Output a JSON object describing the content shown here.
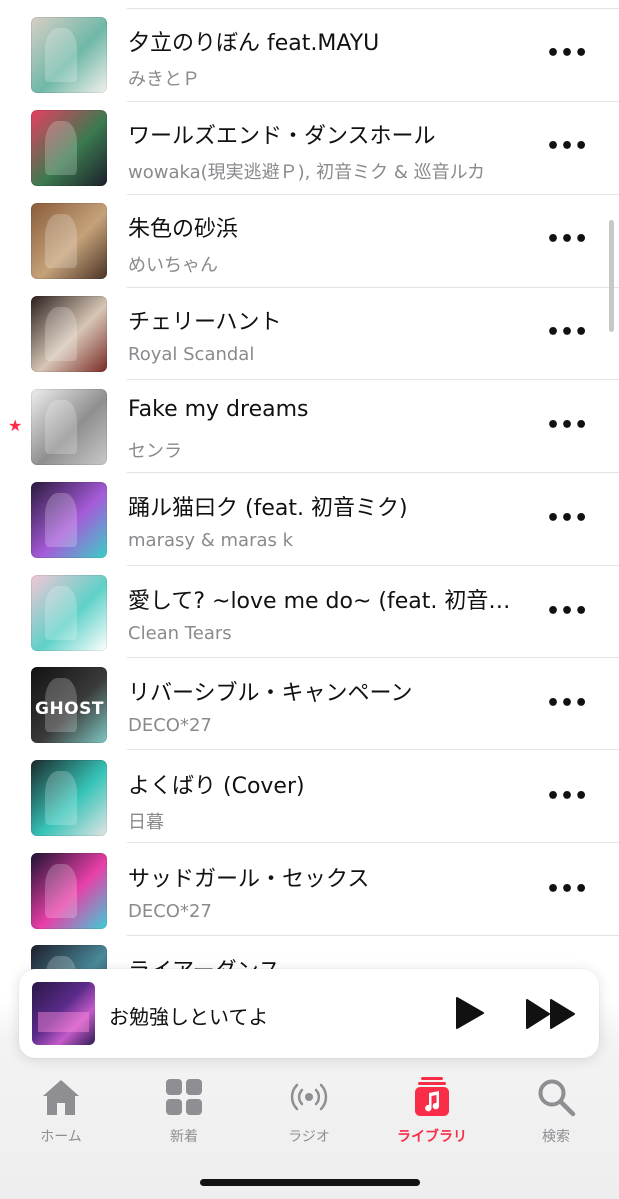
{
  "song_list": {
    "rows": [
      {
        "title": "夕立のりぼん feat.MAYU",
        "artist": "みきとＰ",
        "more_icon": "ellipsis-icon",
        "art_colors": [
          "#d9cfc6",
          "#6fb8a8",
          "#f4f1ec"
        ]
      },
      {
        "title": "ワールズエンド・ダンスホール",
        "artist": "wowaka(現実逃避Ｐ), 初音ミク & 巡音ルカ",
        "more_icon": "ellipsis-icon",
        "art_colors": [
          "#e83e62",
          "#3b7a4f",
          "#1c1f2a"
        ]
      },
      {
        "title": "朱色の砂浜",
        "artist": "めいちゃん",
        "more_icon": "ellipsis-icon",
        "art_colors": [
          "#8a5c3a",
          "#c5a27a",
          "#4a3325"
        ]
      },
      {
        "title": "チェリーハント",
        "artist": "Royal Scandal",
        "more_icon": "ellipsis-icon",
        "art_colors": [
          "#2b1f1c",
          "#d7c6b6",
          "#7a2a26"
        ]
      },
      {
        "title": "Fake my dreams",
        "artist": "センラ",
        "more_icon": "ellipsis-icon",
        "favorite": true,
        "favorite_icon": "star-icon",
        "art_colors": [
          "#eeeeee",
          "#8f8f8f",
          "#c9c9c9"
        ]
      },
      {
        "title": "踊ル猫曰ク (feat. 初音ミク)",
        "artist": "marasy & maras k",
        "more_icon": "ellipsis-icon",
        "art_colors": [
          "#2a1a3c",
          "#a55bd9",
          "#39d0c7"
        ]
      },
      {
        "title": "愛して? ~love me do~ (feat. 初音…",
        "artist": "Clean Tears",
        "more_icon": "ellipsis-icon",
        "art_colors": [
          "#f3c6d6",
          "#5fd1c8",
          "#ffffff"
        ]
      },
      {
        "title": "リバーシブル・キャンペーン",
        "artist": "DECO*27",
        "more_icon": "ellipsis-icon",
        "badge": "GHOST",
        "art_colors": [
          "#111111",
          "#3a3a3a",
          "#7fc9c4"
        ]
      },
      {
        "title": "よくばり (Cover)",
        "artist": "日暮",
        "more_icon": "ellipsis-icon",
        "art_colors": [
          "#1a2a2a",
          "#36c4b8",
          "#e4e4e4"
        ]
      },
      {
        "title": "サッドガール・セックス",
        "artist": "DECO*27",
        "more_icon": "ellipsis-icon",
        "art_colors": [
          "#1d1330",
          "#e83fa8",
          "#3ad0d6"
        ]
      },
      {
        "title": "ライアーダンス",
        "artist": "",
        "more_icon": "ellipsis-icon",
        "art_colors": [
          "#1d1d2a",
          "#4a8a9a",
          "#2a2a3a"
        ]
      }
    ]
  },
  "mini_player": {
    "title": "お勉強しといてよ",
    "play_icon": "play-icon",
    "next_icon": "fast-forward-icon"
  },
  "tab_bar": {
    "active_color": "#fa2d48",
    "inactive_color": "#8e8e93",
    "tabs": [
      {
        "label": "ホーム",
        "icon": "home-icon",
        "active": false
      },
      {
        "label": "新着",
        "icon": "grid-icon",
        "active": false
      },
      {
        "label": "ラジオ",
        "icon": "radio-icon",
        "active": false
      },
      {
        "label": "ライブラリ",
        "icon": "library-icon",
        "active": true
      },
      {
        "label": "検索",
        "icon": "search-icon",
        "active": false
      }
    ]
  }
}
